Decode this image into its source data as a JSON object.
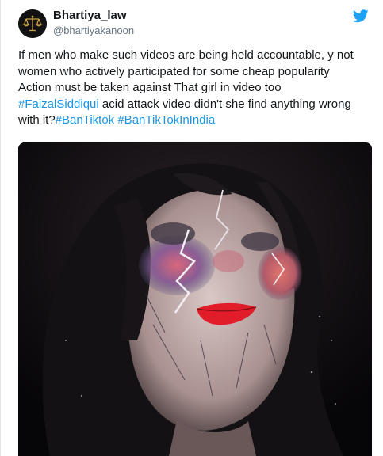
{
  "tweet": {
    "author_name": "Bhartiya_law",
    "author_handle": "@bhartiyakanoon",
    "text_line1": "If men who make such videos are being held accountable, y  not",
    "text_line2": "women who actively participated for some cheap popularity",
    "text_line3": "Action must be taken against That girl in video too",
    "hashtag1": "#FaizalSiddiqui",
    "text_line4_rest": " acid attack video didn't she find anything wrong",
    "text_line5_start": "with it?",
    "hashtag2": "#BanTiktok",
    "hashtag3": "#BanTikTokInIndia"
  },
  "icons": {
    "avatar": "scales-of-justice-logo",
    "brand": "twitter-bird-icon"
  },
  "colors": {
    "hashtag": "#1b95e0",
    "twitter_blue": "#1da1f2",
    "text": "#14171a",
    "muted": "#657786"
  }
}
